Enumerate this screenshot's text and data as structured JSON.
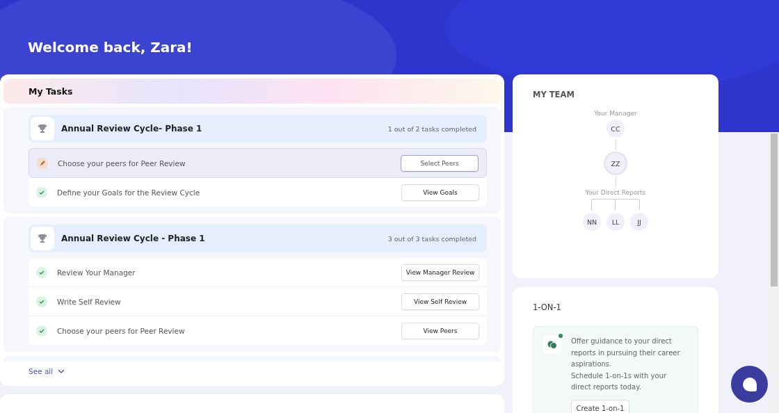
{
  "header": {
    "title": "Welcome back, Zara!"
  },
  "tasks": {
    "title": "My Tasks",
    "see_all": "See all",
    "groups": [
      {
        "title": "Annual Review Cycle- Phase 1",
        "progress": "1 out of 2 tasks completed",
        "items": [
          {
            "label": "Choose your peers for Peer Review",
            "kind": "pending",
            "active": true,
            "button": "Select Peers"
          },
          {
            "label": "Define your Goals for the Review Cycle",
            "kind": "done",
            "active": false,
            "button": "View Goals"
          }
        ]
      },
      {
        "title": "Annual Review Cycle - Phase 1",
        "progress": "3 out of 3 tasks completed",
        "items": [
          {
            "label": "Review Your Manager",
            "kind": "done",
            "active": false,
            "button": "View Manager Review"
          },
          {
            "label": "Write Self Review",
            "kind": "done",
            "active": false,
            "button": "View Self Review"
          },
          {
            "label": "Choose your peers for Peer Review",
            "kind": "done",
            "active": false,
            "button": "View Peers"
          }
        ]
      }
    ]
  },
  "team": {
    "title": "MY TEAM",
    "manager_label": "Your Manager",
    "manager": "CC",
    "self": "ZZ",
    "reports_label": "Your Direct Reports",
    "reports": [
      "NN",
      "LL",
      "JJ"
    ]
  },
  "one_on_one": {
    "title": "1-ON-1",
    "text": "Offer guidance to your direct reports in pursuing their career aspirations.",
    "text2": "Schedule 1-on-1s with your direct reports today.",
    "button": "Create 1-on-1"
  }
}
